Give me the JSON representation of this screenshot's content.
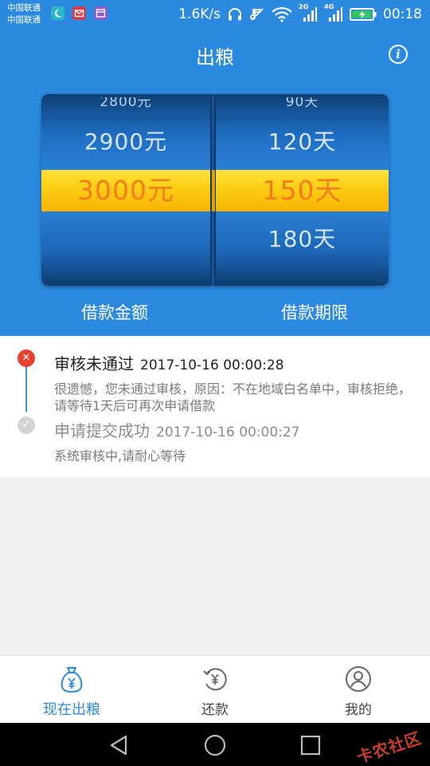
{
  "status_bar": {
    "carrier_1": "中国联通",
    "carrier_2": "中国联通",
    "net_speed": "1.6K/s",
    "signal_1_label": "2G",
    "signal_2_label": "4G",
    "time": "00:18",
    "icons": [
      "moon-app-icon",
      "mail-app-icon",
      "calendar-app-icon",
      "headphones-icon",
      "mute-icon",
      "wifi-icon",
      "signal-icon",
      "battery-charging-icon"
    ]
  },
  "header": {
    "title": "出粮",
    "info_icon": "i"
  },
  "picker": {
    "amount": {
      "above_2": "2800元",
      "above_1": "2900元",
      "selected": "3000元",
      "below_1": ""
    },
    "term": {
      "above_2": "90天",
      "above_1": "120天",
      "selected": "150天",
      "below_1": "180天"
    },
    "amount_label": "借款金额",
    "term_label": "借款期限"
  },
  "timeline": {
    "events": [
      {
        "title": "审核未通过",
        "time": "2017-10-16 00:00:28",
        "description": "很遗憾，您未通过审核，原因：不在地域白名单中，审核拒绝，请等待1天后可再次申请借款",
        "status": "failed"
      },
      {
        "title": "申请提交成功",
        "time": "2017-10-16 00:00:27",
        "description": "系统审核中,请耐心等待",
        "status": "done"
      }
    ]
  },
  "bottom_nav": {
    "items": [
      {
        "label": "现在出粮",
        "icon": "money-bag-icon",
        "active": true
      },
      {
        "label": "还款",
        "icon": "repay-icon",
        "active": false
      },
      {
        "label": "我的",
        "icon": "user-icon",
        "active": false
      }
    ]
  },
  "watermark": "卡农社区",
  "colors": {
    "primary": "#2b8ae0",
    "highlight": "#ffd21a",
    "selected_text": "#f47c1e",
    "fail": "#e8412f"
  }
}
